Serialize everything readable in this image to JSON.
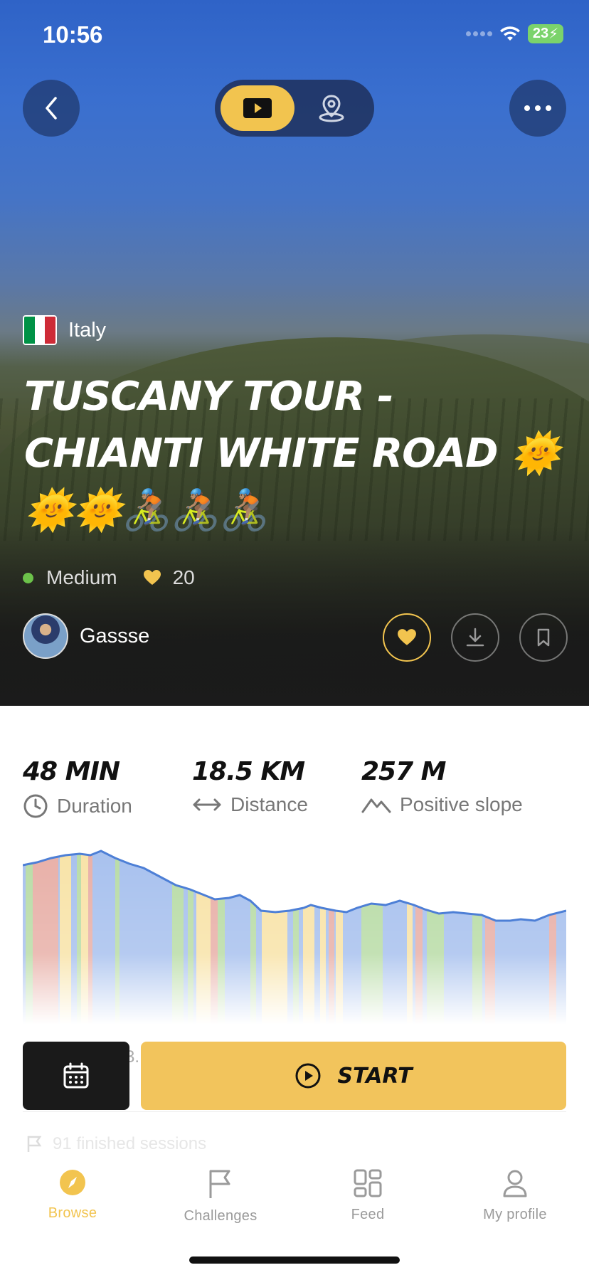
{
  "status": {
    "time": "10:56",
    "battery": "23"
  },
  "hero": {
    "country": "Italy",
    "title": "TUSCANY TOUR - CHIANTI WHITE ROAD 🌞🌞🌞🚴🏽🚴🏽🚴🏽",
    "difficulty": "Medium",
    "likes": "20",
    "author": "Gassse",
    "flag_colors": [
      "#009246",
      "#ffffff",
      "#ce2b37"
    ]
  },
  "stats": {
    "duration_value": "48 MIN",
    "duration_label": "Duration",
    "distance_value": "18.5 KM",
    "distance_label": "Distance",
    "slope_value": "257 M",
    "slope_label": "Positive slope"
  },
  "actions": {
    "start_label": "START",
    "hidden_peek": "3."
  },
  "sessions": {
    "label": "91 finished sessions"
  },
  "tabs": [
    {
      "label": "Browse"
    },
    {
      "label": "Challenges"
    },
    {
      "label": "Feed"
    },
    {
      "label": "My profile"
    }
  ],
  "colors": {
    "accent": "#f2c44f",
    "difficulty": "#6cc24a",
    "dark": "#1a1a1a"
  }
}
